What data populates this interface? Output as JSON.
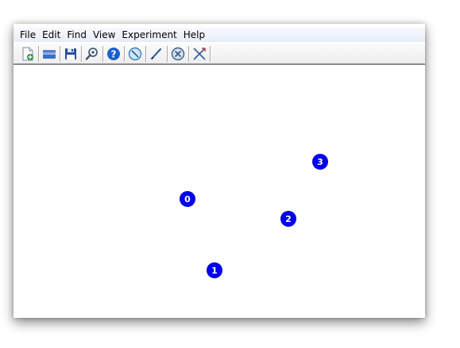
{
  "menu": {
    "items": [
      {
        "label": "File"
      },
      {
        "label": "Edit"
      },
      {
        "label": "Find"
      },
      {
        "label": "View"
      },
      {
        "label": "Experiment"
      },
      {
        "label": "Help"
      }
    ]
  },
  "toolbar": {
    "buttons": [
      {
        "icon": "new-document-icon"
      },
      {
        "icon": "open-folder-icon"
      },
      {
        "icon": "save-disk-icon"
      },
      {
        "icon": "zoom-magnifier-icon"
      },
      {
        "icon": "help-question-icon"
      },
      {
        "icon": "compass-icon"
      },
      {
        "icon": "pen-edit-icon"
      },
      {
        "icon": "delete-x-circle-icon"
      },
      {
        "icon": "cut-tools-icon"
      }
    ]
  },
  "colors": {
    "node_fill": "#0000ee",
    "node_text": "#ffffff"
  },
  "canvas": {
    "nodes": [
      {
        "label": "0"
      },
      {
        "label": "1"
      },
      {
        "label": "2"
      },
      {
        "label": "3"
      }
    ]
  }
}
